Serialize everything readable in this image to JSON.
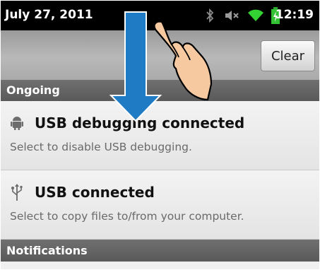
{
  "status_bar": {
    "date": "July 27, 2011",
    "time": "12:19",
    "icons": [
      "bluetooth-icon",
      "mute-icon",
      "wifi-icon",
      "battery-icon"
    ]
  },
  "header": {
    "clear_label": "Clear"
  },
  "sections": {
    "ongoing": "Ongoing",
    "notifications": "Notifications"
  },
  "items": [
    {
      "title": "USB debugging connected",
      "subtitle": "Select to disable USB debugging.",
      "icon": "android-icon"
    },
    {
      "title": "USB connected",
      "subtitle": "Select to copy files to/from your computer.",
      "icon": "usb-icon"
    }
  ],
  "overlay": {
    "arrow": "down-arrow",
    "hand": "swipe-hand",
    "arrow_color": "#1e7bc4"
  }
}
